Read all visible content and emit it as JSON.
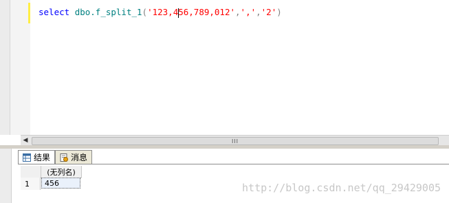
{
  "editor": {
    "tokens": {
      "kw": "select",
      "fn": "dbo.f_split_1",
      "open": "(",
      "s1a": "'123,4",
      "s1b": "56,789,012'",
      "c1": ",",
      "s2": "','",
      "c2": ",",
      "s3": "'2'",
      "close": ")"
    }
  },
  "scrollbar": {
    "grip": "III"
  },
  "tabs": [
    {
      "label": "结果"
    },
    {
      "label": "消息"
    }
  ],
  "grid": {
    "column_header": "(无列名)",
    "rows": [
      {
        "num": "1",
        "value": "456"
      }
    ]
  },
  "watermark": "http://blog.csdn.net/qq_29429005"
}
